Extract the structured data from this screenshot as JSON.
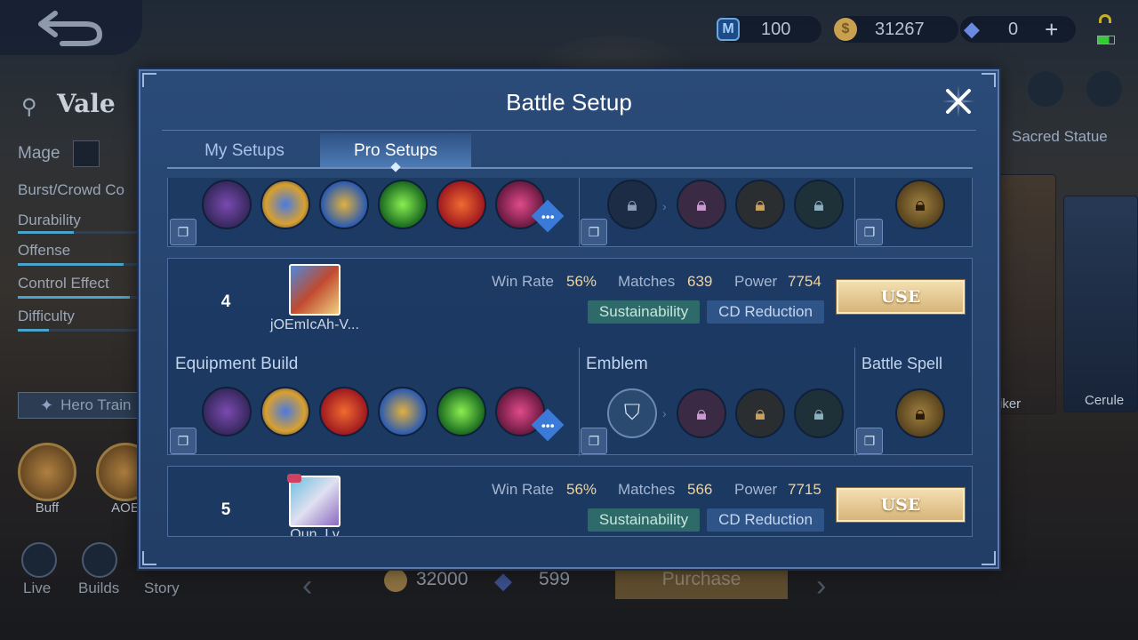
{
  "topbar": {
    "tickets": "100",
    "gold": "31267",
    "diamonds": "0",
    "plus": "+"
  },
  "hero": {
    "name": "Vale",
    "role": "Mage",
    "specialty": "Burst/Crowd Co",
    "stats": [
      {
        "label": "Durability",
        "value": 0.45
      },
      {
        "label": "Offense",
        "value": 0.85
      },
      {
        "label": "Control Effect",
        "value": 0.9
      },
      {
        "label": "Difficulty",
        "value": 0.25
      }
    ],
    "train_label": "Hero Train",
    "skills": [
      {
        "label": "Buff"
      },
      {
        "label": "AOE"
      }
    ],
    "nav": {
      "live": "Live",
      "builds": "Builds",
      "story": "Story"
    }
  },
  "right_panel": {
    "header": "Sacred Statue",
    "skin1": "iker",
    "skin2": "Cerule"
  },
  "bottom": {
    "price_gold": "32000",
    "price_diamond": "599",
    "purchase": "Purchase"
  },
  "modal": {
    "title": "Battle Setup",
    "tabs": [
      {
        "label": "My Setups",
        "active": false
      },
      {
        "label": "Pro Setups",
        "active": true
      }
    ],
    "section_labels": {
      "equipment": "Equipment Build",
      "emblem": "Emblem",
      "spell": "Battle Spell"
    },
    "builds": [
      {
        "rank": "4",
        "player": "jOEmIcAh-V...",
        "win_rate_label": "Win Rate",
        "win_rate": "56%",
        "matches_label": "Matches",
        "matches": "639",
        "power_label": "Power",
        "power": "7754",
        "tags": [
          "Sustainability",
          "CD Reduction"
        ],
        "use": "USE"
      },
      {
        "rank": "5",
        "player": "Oun_Ly",
        "win_rate_label": "Win Rate",
        "win_rate": "56%",
        "matches_label": "Matches",
        "matches": "566",
        "power_label": "Power",
        "power": "7715",
        "tags": [
          "Sustainability",
          "CD Reduction"
        ],
        "use": "USE"
      }
    ],
    "colors": {
      "modal_bg": "#26446e",
      "use_btn": "#e8cf98",
      "tag_green": "#2f6a6a",
      "tag_blue": "#2e5488",
      "stat_value": "#f0d39a"
    }
  }
}
